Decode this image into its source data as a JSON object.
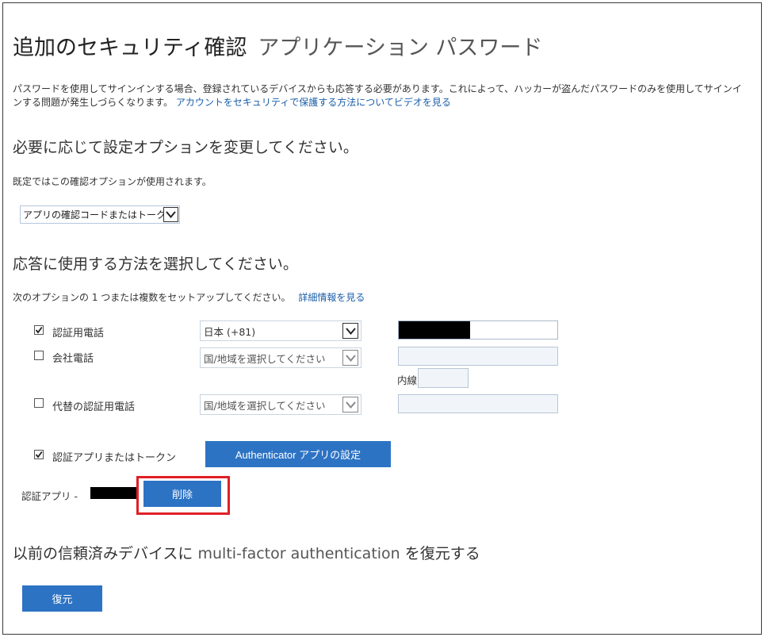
{
  "header": {
    "title": "追加のセキュリティ確認",
    "subtitle": "アプリケーション パスワード"
  },
  "intro": {
    "text": "パスワードを使用してサインインする場合、登録されているデバイスからも応答する必要があります。これによって、ハッカーが盗んだパスワードのみを使用してサインインする問題が発生しづらくなります。",
    "link": "アカウントをセキュリティで保護する方法についてビデオを見る"
  },
  "default_option": {
    "heading": "必要に応じて設定オプションを変更してください。",
    "description": "既定ではこの確認オプションが使用されます。",
    "selected": "アプリの確認コードまたはトークン"
  },
  "methods_section": {
    "heading": "応答に使用する方法を選択してください。",
    "description": "次のオプションの 1 つまたは複数をセットアップしてください。",
    "link": "詳細情報を見る"
  },
  "methods": [
    {
      "label": "認証用電話",
      "checked": true,
      "country": "日本 (+81)",
      "phone": "[redacted]"
    },
    {
      "label": "会社電話",
      "checked": false,
      "country": "国/地域を選択してください",
      "extension_label": "内線"
    },
    {
      "label": "代替の認証用電話",
      "checked": false,
      "country": "国/地域を選択してください"
    }
  ],
  "authenticator": {
    "label": "認証アプリまたはトークン",
    "checked": true,
    "setup_button": "Authenticator アプリの設定",
    "app_label": "認証アプリ -",
    "delete_button": "削除"
  },
  "restore": {
    "heading_prefix": "以前の信頼済みデバイスに",
    "heading_latin": "multi-factor authentication",
    "heading_suffix": "を復元する",
    "button": "復元"
  },
  "colors": {
    "button_blue": "#2d73c4",
    "link_blue": "#1a5ea8",
    "highlight_red": "#e01f26"
  }
}
